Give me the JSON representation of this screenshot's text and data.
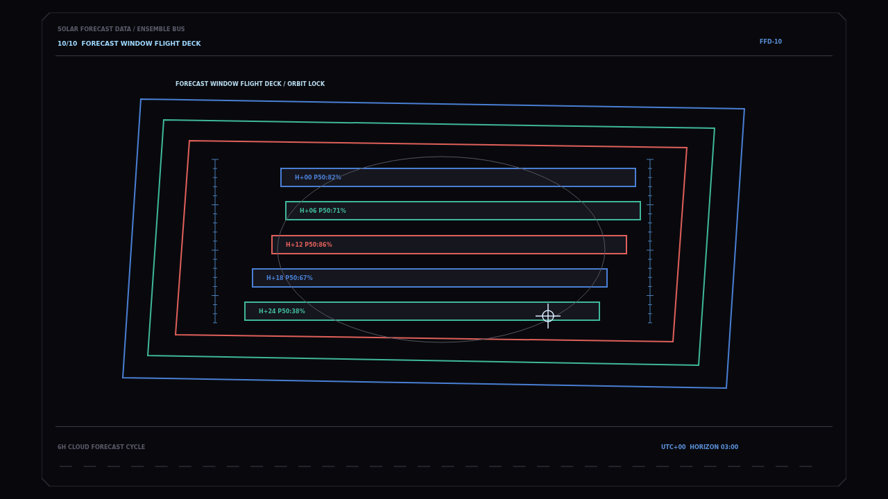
{
  "header": {
    "kicker": "SOLAR FORECAST DATA / ENSEMBLE BUS",
    "title": "10/10  FORECAST WINDOW FLIGHT DECK",
    "code": "FFD-10"
  },
  "deck": {
    "caption": "FORECAST WINDOW FLIGHT DECK / ORBIT LOCK",
    "frames": [
      {
        "color": "#4a7fd4"
      },
      {
        "color": "#3fb89a"
      },
      {
        "color": "#e0605a"
      }
    ],
    "bars": [
      {
        "label": "H+00 P50:82%",
        "color": "#4a7fd4"
      },
      {
        "label": "H+06 P50:71%",
        "color": "#3fb89a"
      },
      {
        "label": "H+12 P50:86%",
        "color": "#e0605a"
      },
      {
        "label": "H+18 P50:67%",
        "color": "#4a7fd4"
      },
      {
        "label": "H+24 P50:38%",
        "color": "#3fb89a"
      }
    ]
  },
  "footer": {
    "left": "6H CLOUD FORECAST CYCLE",
    "right": "UTC+00  HORIZON 03:00"
  }
}
